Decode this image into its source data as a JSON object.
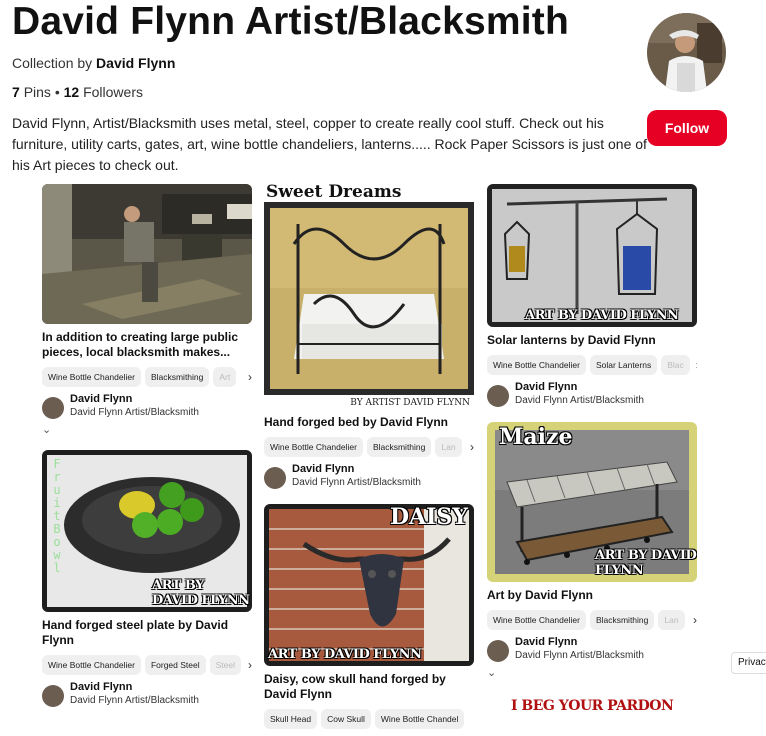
{
  "header": {
    "title": "David Flynn Artist/Blacksmith",
    "collection_prefix": "Collection by",
    "collection_owner": "David Flynn",
    "pins_count": "7",
    "pins_label": "Pins",
    "separator": "•",
    "followers_count": "12",
    "followers_label": "Followers",
    "description": "David Flynn, Artist/Blacksmith uses metal, steel, copper to create really cool stuff. Check out his furniture, utility carts, gates, art, wine bottle chandeliers, lanterns..... Rock Paper Scissors is just one of his Art pieces to check out.",
    "follow_label": "Follow"
  },
  "pins": [
    {
      "title": "In addition to creating large public pieces, local blacksmith makes...",
      "tags": [
        "Wine Bottle Chandelier",
        "Blacksmithing",
        "Art"
      ],
      "author": "David Flynn",
      "board": "David Flynn Artist/Blacksmith",
      "more": "⌄"
    },
    {
      "overlay": "Sweet Dreams",
      "watermark": "BY ARTIST DAVID FLYNN",
      "title": "Hand forged bed by David Flynn",
      "tags": [
        "Wine Bottle Chandelier",
        "Blacksmithing",
        "Lan"
      ],
      "author": "David Flynn",
      "board": "David Flynn Artist/Blacksmith"
    },
    {
      "watermark": "ART BY DAVID FLYNN",
      "title": "Solar lanterns by David Flynn",
      "tags": [
        "Wine Bottle Chandelier",
        "Solar Lanterns",
        "Blac"
      ],
      "author": "David Flynn",
      "board": "David Flynn Artist/Blacksmith"
    },
    {
      "overlay": "Fruit Bowl",
      "watermark": "ART BY DAVID FLYNN",
      "title": "Hand forged steel plate by David Flynn",
      "tags": [
        "Wine Bottle Chandelier",
        "Forged Steel",
        "Steel"
      ],
      "author": "David Flynn",
      "board": "David Flynn Artist/Blacksmith"
    },
    {
      "overlay": "DAISY",
      "watermark": "ART BY DAVID FLYNN",
      "title": "Daisy, cow skull hand forged by David Flynn",
      "tags": [
        "Skull Head",
        "Cow Skull",
        "Wine Bottle Chandel"
      ]
    },
    {
      "overlay": "Maize",
      "watermark": "ART BY DAVID FLYNN",
      "title": "Art by David Flynn",
      "tags": [
        "Wine Bottle Chandelier",
        "Blacksmithing",
        "Lan"
      ],
      "author": "David Flynn",
      "board": "David Flynn Artist/Blacksmith",
      "more": "⌄"
    },
    {
      "overlay": "I BEG YOUR PARDON"
    }
  ],
  "privacy_label": "Privacy",
  "icons": {
    "tag_scroll": "chevron-right-icon",
    "expand": "chevron-down-icon"
  }
}
